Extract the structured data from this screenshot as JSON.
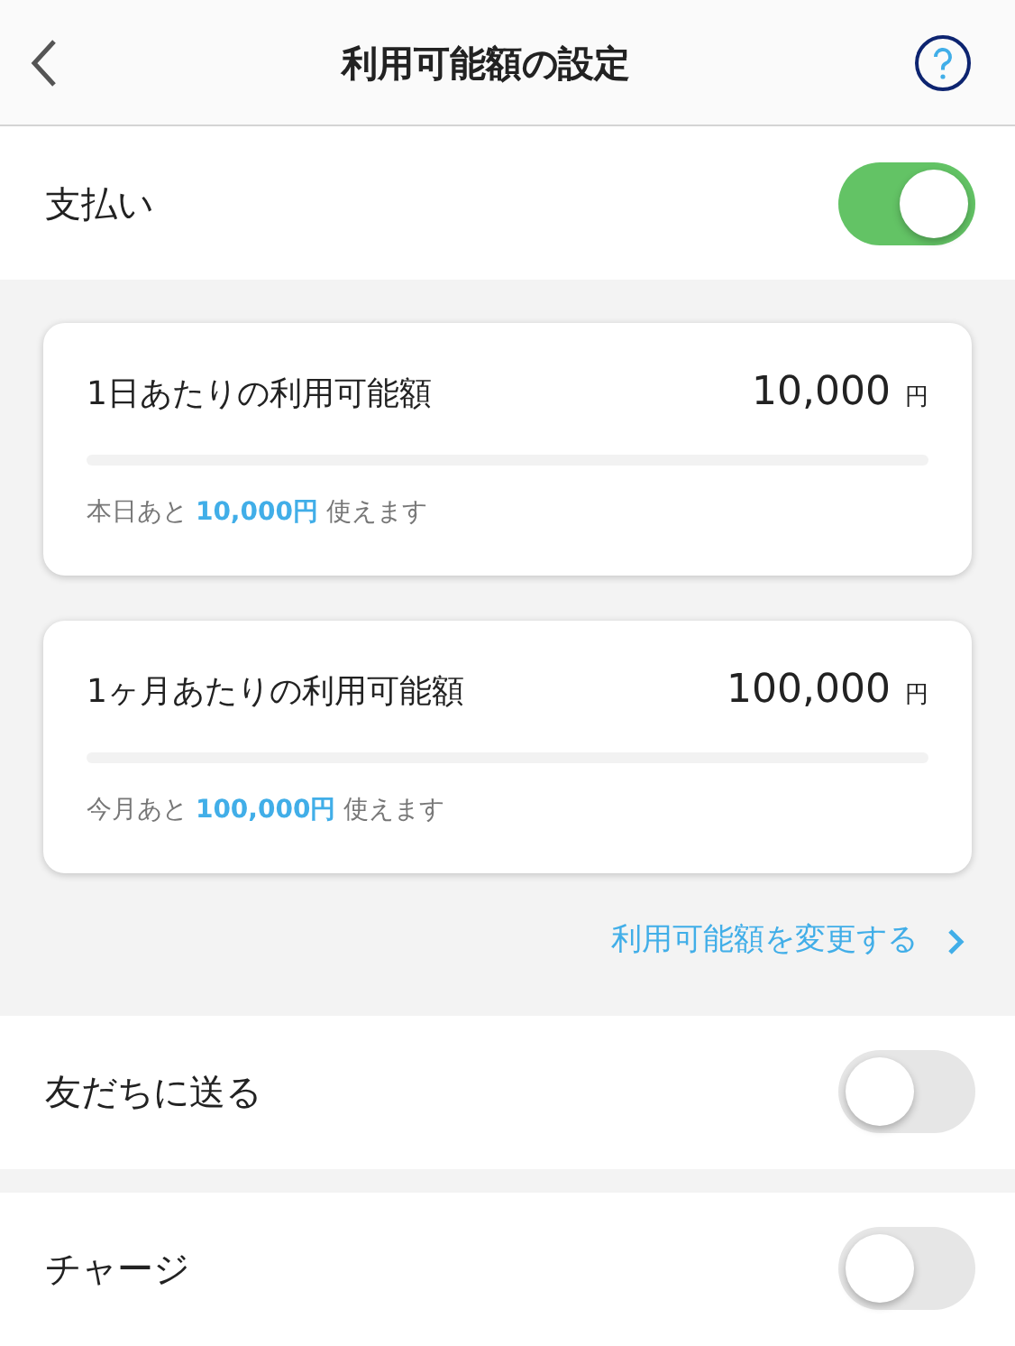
{
  "header": {
    "title": "利用可能額の設定"
  },
  "payment": {
    "label": "支払い",
    "on": true
  },
  "limits": [
    {
      "title": "1日あたりの利用可能額",
      "amount": "10,000",
      "unit": "円",
      "remaining": "本日あと **10,000円** 使えます"
    },
    {
      "title": "1ヶ月あたりの利用可能額",
      "amount": "100,000",
      "unit": "円",
      "remaining": "今月あと **100,000円** 使えます"
    }
  ],
  "change_link": "利用可能額を変更する",
  "settings": [
    {
      "label": "友だちに送る",
      "on": false
    },
    {
      "label": "チャージ",
      "on": false
    }
  ]
}
